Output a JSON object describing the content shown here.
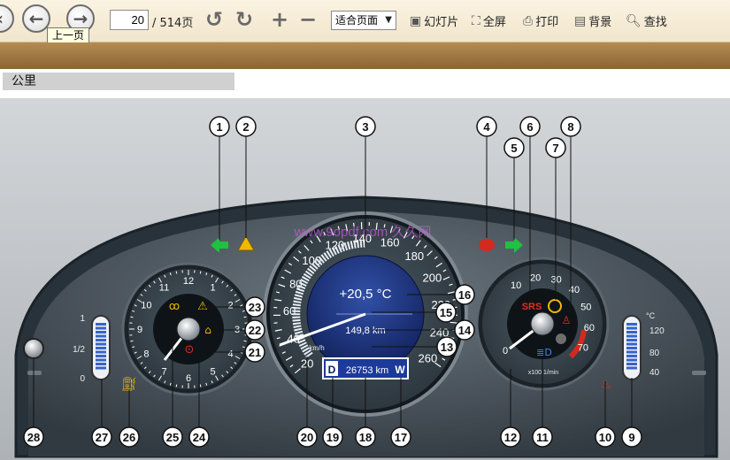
{
  "toolbar": {
    "back_tooltip": "上一页",
    "current_page": "20",
    "total_pages": "/ 514页",
    "zoom_mode": "适合页面",
    "slideshow_label": "幻灯片",
    "fullscreen_label": "全屏",
    "print_label": "打印",
    "background_label": "背景",
    "find_label": "查找"
  },
  "section_heading": "公里",
  "figure": {
    "watermark": "www.9opdf.com 久久网",
    "speed_ticks": [
      "20",
      "40",
      "60",
      "80",
      "100",
      "120",
      "140",
      "160",
      "180",
      "200",
      "220",
      "240",
      "260"
    ],
    "speed_unit": "km/h",
    "tacho_ticks": [
      "10",
      "20",
      "30",
      "40",
      "50",
      "60",
      "70"
    ],
    "tacho_unit": "x100 1/min",
    "clock_ticks": [
      "12",
      "1",
      "2",
      "3",
      "4",
      "5",
      "6",
      "7",
      "8",
      "9",
      "10",
      "11"
    ],
    "temperature": "+20,5 °C",
    "trip_distance": "149,8 km",
    "gear": "D",
    "odometer": "26753 km",
    "mode": "W",
    "fuel_ticks": [
      "1",
      "1/2",
      "0"
    ],
    "coolant_unit": "°C",
    "coolant_ticks": [
      "120",
      "80",
      "40"
    ],
    "srs_label": "SRS",
    "callouts": [
      "1",
      "2",
      "3",
      "4",
      "5",
      "6",
      "7",
      "8",
      "9",
      "10",
      "11",
      "12",
      "13",
      "14",
      "15",
      "16",
      "17",
      "18",
      "19",
      "20",
      "21",
      "22",
      "23",
      "24",
      "25",
      "26",
      "27",
      "28"
    ]
  }
}
